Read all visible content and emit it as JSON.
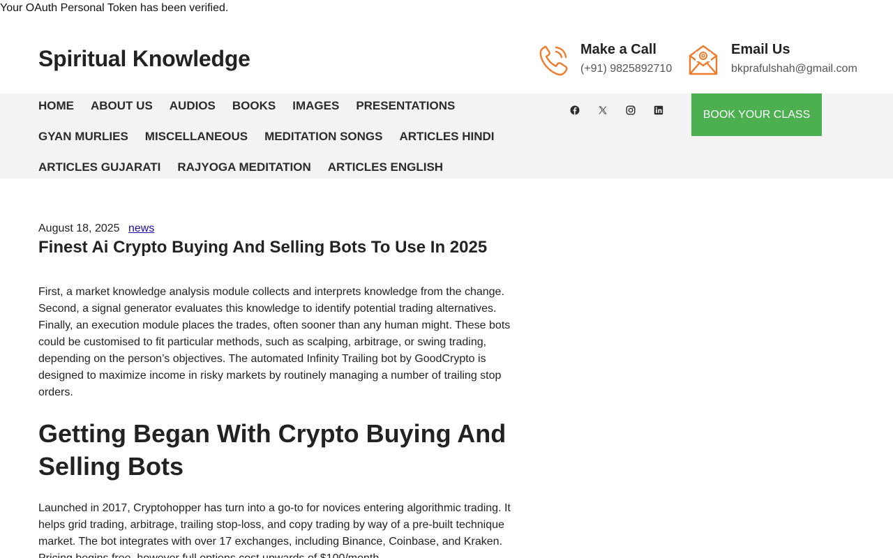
{
  "notice": "Your OAuth Personal Token has been verified.",
  "site": {
    "title": "Spiritual Knowledge"
  },
  "contact": {
    "call": {
      "title": "Make a Call",
      "value": "(+91) 9825892710",
      "icon": "phone-icon"
    },
    "email": {
      "title": "Email Us",
      "value": "bkprafulshah@gmail.com",
      "icon": "envelope-icon"
    }
  },
  "nav": {
    "row1": [
      "HOME",
      "ABOUT US",
      "AUDIOS",
      "BOOKS",
      "IMAGES",
      "PRESENTATIONS"
    ],
    "row2": [
      "GYAN MURLIES",
      "MISCELLANEOUS",
      "MEDITATION SONGS",
      "ARTICLES HINDI"
    ],
    "row3": [
      "ARTICLES GUJARATI",
      "RAJYOGA MEDITATION",
      "ARTICLES ENGLISH"
    ]
  },
  "social": [
    "facebook-icon",
    "x-icon",
    "instagram-icon",
    "linkedin-icon"
  ],
  "book_button": "BOOK YOUR CLASS",
  "colors": {
    "accent": "#4caf50",
    "icon_orange": "#f07a2a",
    "nav_bg": "#f3f3f3",
    "link": "#1a0dab"
  },
  "post": {
    "date": "August 18, 2025",
    "category": "news",
    "title": "Finest Ai Crypto Buying And Selling Bots To Use In 2025",
    "paragraph1": "First, a market knowledge analysis module collects and interprets knowledge from the change. Second, a signal generator evaluates this knowledge to identify potential trading alternatives. Finally, an execution module places the trades, often sooner than any human might. These bots could be customised to fit particular methods, such as scalping, arbitrage, or swing trading, depending on the person’s objectives. The automated Infinity Trailing bot by GoodCrypto is designed to maximize income in risky markets by routinely managing a number of trailing stop orders.",
    "heading2": "Getting Began With Crypto Buying And Selling Bots",
    "paragraph2": "Launched in 2017, Cryptohopper has turn into a go-to for novices entering algorithmic trading. It helps grid trading, arbitrage, trailing stop-loss, and copy trading by way of a pre-built technique market. The bot integrates with over 17 exchanges, including Binance, Coinbase, and Kraken. Pricing begins free, however full options cost upwards of $100/month."
  }
}
